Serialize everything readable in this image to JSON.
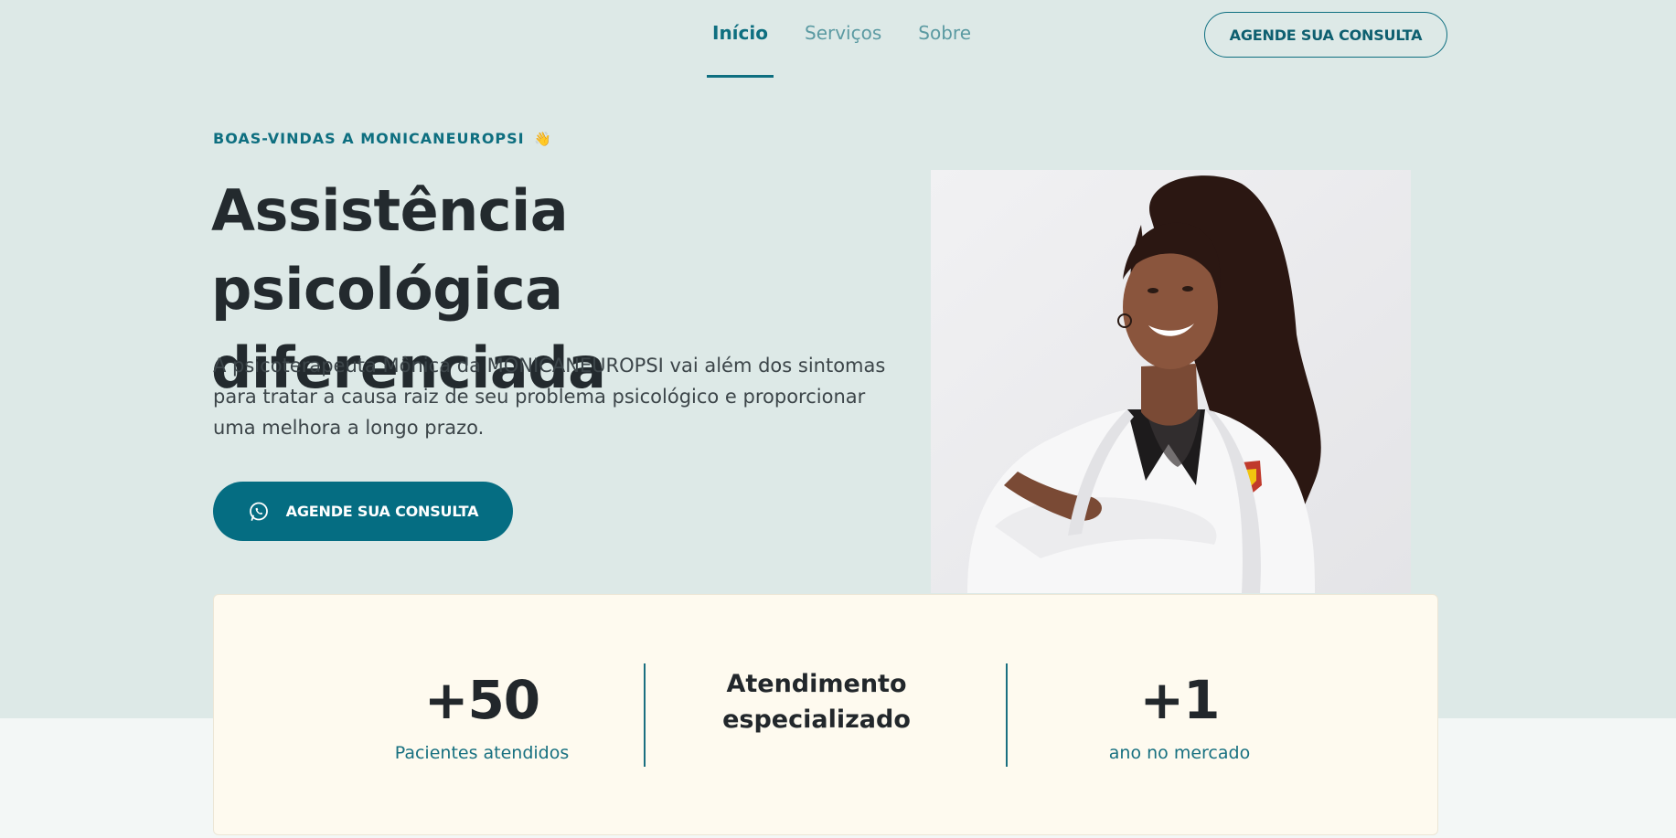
{
  "nav": {
    "links": [
      {
        "label": "Início",
        "active": true
      },
      {
        "label": "Serviços",
        "active": false
      },
      {
        "label": "Sobre",
        "active": false
      }
    ],
    "cta_label": "AGENDE SUA CONSULTA"
  },
  "hero": {
    "eyebrow": "BOAS-VINDAS A MONICANEUROPSI",
    "eyebrow_emoji": "👋",
    "headline_line1": "Assistência psicológica",
    "headline_line2": "diferenciada",
    "lead": "A psicoterapeuta Mônica da MONICANEUROPSI vai além dos sintomas para tratar a causa raiz de seu problema psicológico e proporcionar uma melhora a longo prazo.",
    "cta_label": "AGENDE SUA CONSULTA",
    "cta_icon": "whatsapp-icon"
  },
  "stats": [
    {
      "value": "+50",
      "caption": "Pacientes atendidos"
    },
    {
      "value_line1": "Atendimento",
      "value_line2": "especializado"
    },
    {
      "value": "+1",
      "caption": "ano no mercado"
    }
  ],
  "colors": {
    "primary": "#056d82",
    "hero_bg": "#dde9e7",
    "card_bg": "#fefaef",
    "text_dark": "#232a2e"
  }
}
